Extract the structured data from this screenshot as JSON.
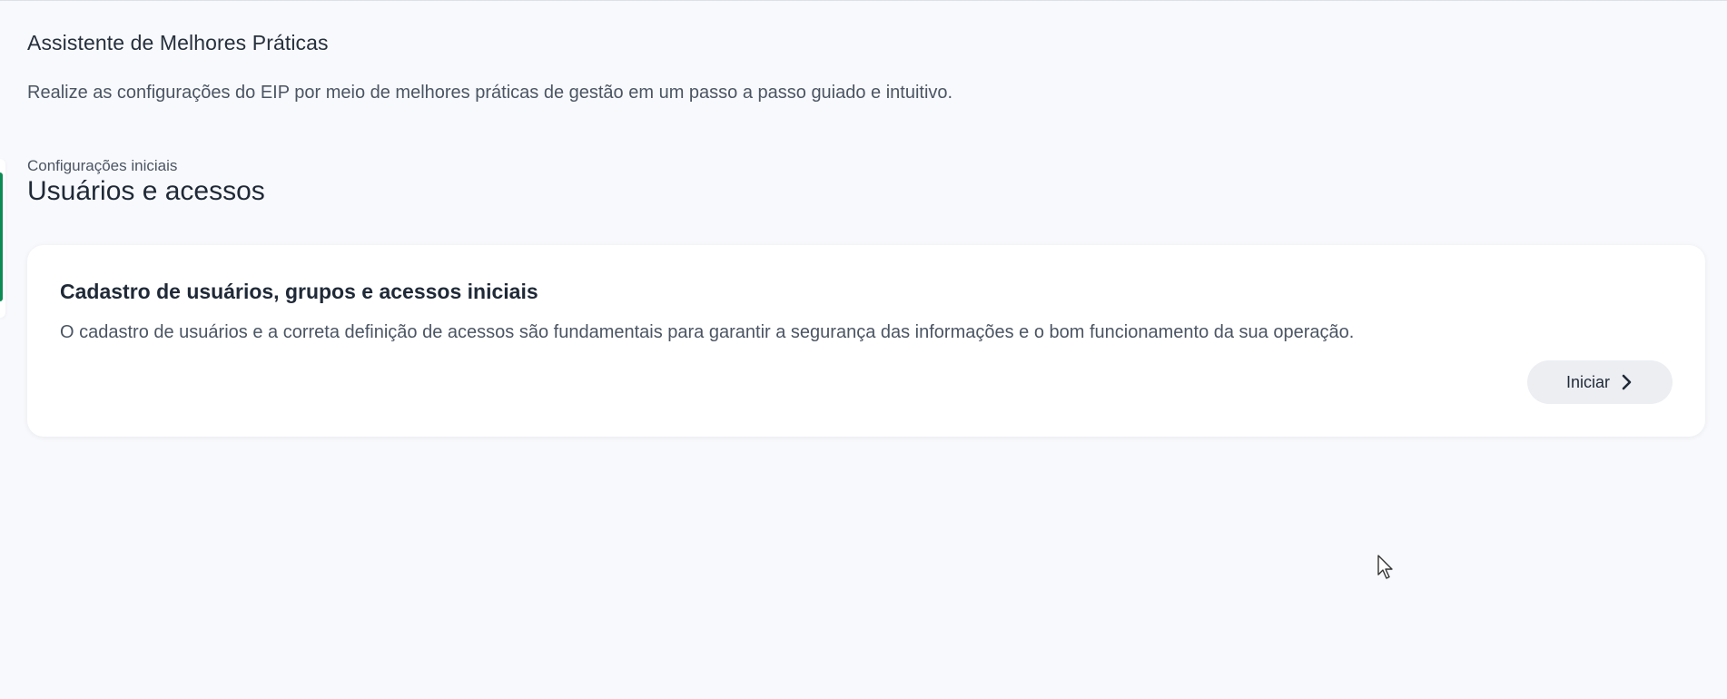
{
  "header": {
    "title": "Assistente de Melhores Práticas",
    "description": "Realize as configurações do EIP por meio de melhores práticas de gestão em um passo a passo guiado e intuitivo."
  },
  "section": {
    "eyebrow": "Configurações iniciais",
    "title": "Usuários e acessos"
  },
  "card": {
    "title": "Cadastro de usuários, grupos e acessos iniciais",
    "text": "O cadastro de usuários e a correta definição de acessos são fundamentais para garantir a segurança das informações e o bom funcionamento da sua operação.",
    "button_label": "Iniciar",
    "button_icon": "chevron-right-icon"
  },
  "colors": {
    "background": "#f8f9fc",
    "accent": "#0d8b55",
    "button_bg": "#eceef2",
    "text": "#1f2937",
    "muted_text": "#4b5563"
  }
}
